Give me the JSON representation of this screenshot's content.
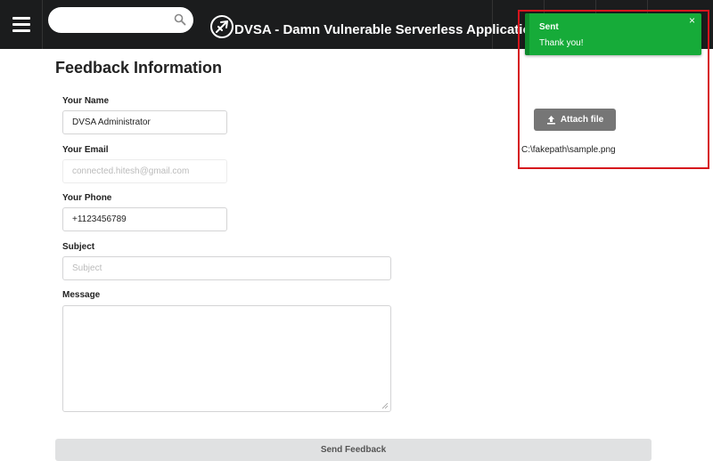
{
  "header": {
    "app_title": "DVSA - Damn Vulnerable Serverless Application",
    "search": {
      "value": "",
      "placeholder": ""
    }
  },
  "main": {
    "title": "Feedback Information",
    "fields": {
      "name": {
        "label": "Your Name",
        "value": "DVSA Administrator",
        "placeholder": ""
      },
      "email": {
        "label": "Your Email",
        "value": "",
        "placeholder": "connected.hitesh@gmail.com"
      },
      "phone": {
        "label": "Your Phone",
        "value": "+1123456789",
        "placeholder": ""
      },
      "subject": {
        "label": "Subject",
        "value": "",
        "placeholder": "Subject"
      },
      "message": {
        "label": "Message",
        "value": "",
        "placeholder": ""
      }
    },
    "submit_label": "Send Feedback"
  },
  "notification": {
    "title": "Sent",
    "message": "Thank you!",
    "close_glyph": "×",
    "color": "#16ab39"
  },
  "attachment": {
    "button_label": "Attach file",
    "file_path": "C:\\fakepath\\sample.png"
  },
  "colors": {
    "header_bg": "#1b1c1d",
    "highlight_border": "#d6151d",
    "attach_button": "#767676",
    "send_button": "#e0e1e2"
  },
  "icons": [
    "menu-icon",
    "search-icon",
    "plane-logo-icon",
    "upload-icon",
    "close-icon"
  ]
}
